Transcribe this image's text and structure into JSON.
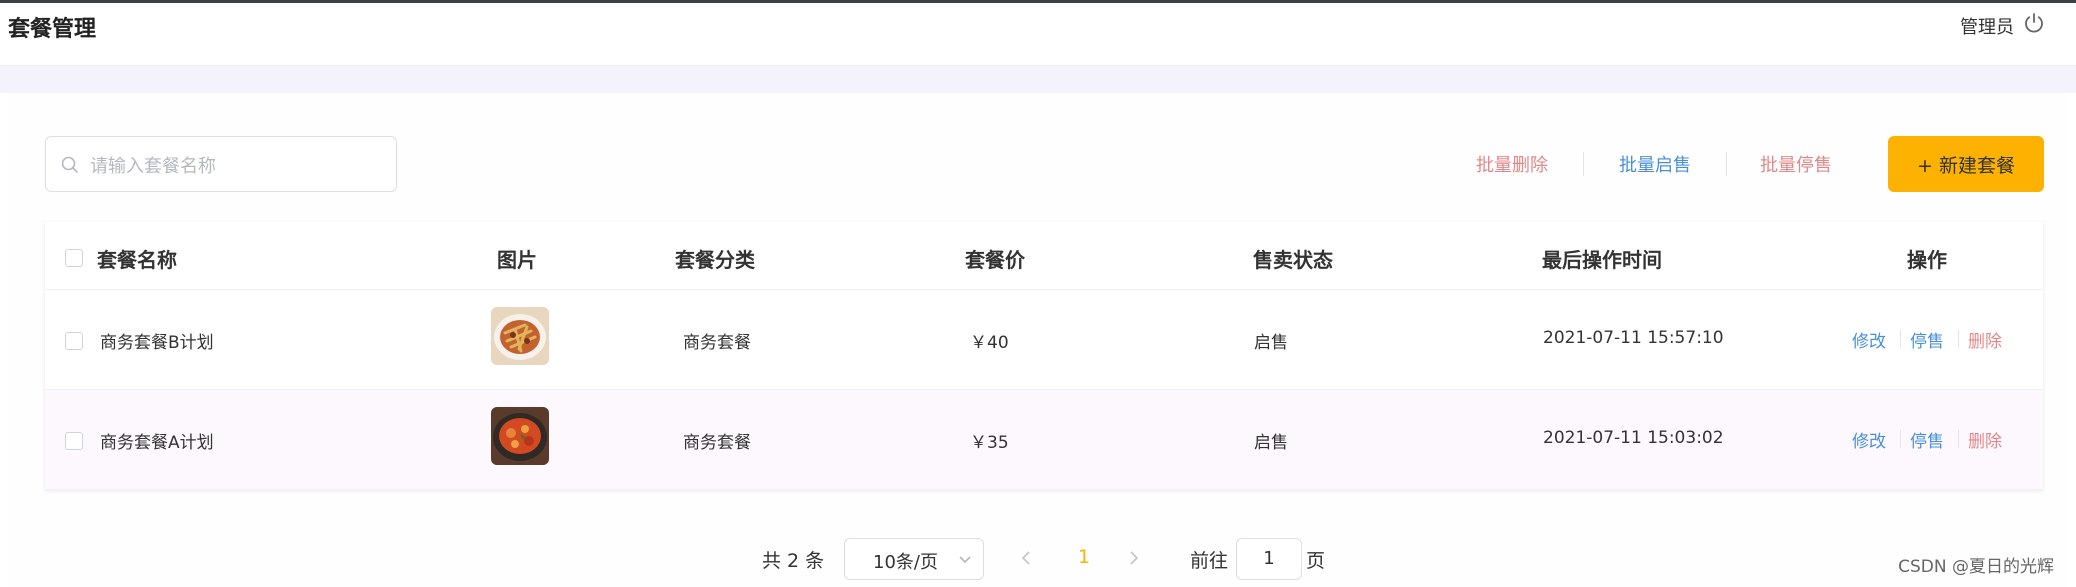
{
  "header": {
    "title": "套餐管理",
    "user": "管理员",
    "logout_icon": "power-icon"
  },
  "toolbar": {
    "search_placeholder": "请输入套餐名称",
    "batch_delete": "批量删除",
    "batch_enable": "批量启售",
    "batch_disable": "批量停售",
    "new_button": "+ 新建套餐"
  },
  "table": {
    "columns": [
      "套餐名称",
      "图片",
      "套餐分类",
      "套餐价",
      "售卖状态",
      "最后操作时间",
      "操作"
    ],
    "rows": [
      {
        "name": "商务套餐B计划",
        "image": "food-thumbnail",
        "category": "商务套餐",
        "price": "￥40",
        "status": "启售",
        "updated": "2021-07-11 15:57:10",
        "actions": [
          "修改",
          "停售",
          "删除"
        ]
      },
      {
        "name": "商务套餐A计划",
        "image": "food-thumbnail",
        "category": "商务套餐",
        "price": "￥35",
        "status": "启售",
        "updated": "2021-07-11 15:03:02",
        "actions": [
          "修改",
          "停售",
          "删除"
        ]
      }
    ]
  },
  "pagination": {
    "total": "共 2 条",
    "page_size": "10条/页",
    "current_page": "1",
    "goto_label": "前往",
    "goto_value": "1",
    "page_suffix": "页"
  },
  "watermark": "CSDN @夏日的光辉",
  "colors": {
    "accent": "#fdb100",
    "link_blue": "#4a90d9",
    "danger": "#e2888a"
  }
}
